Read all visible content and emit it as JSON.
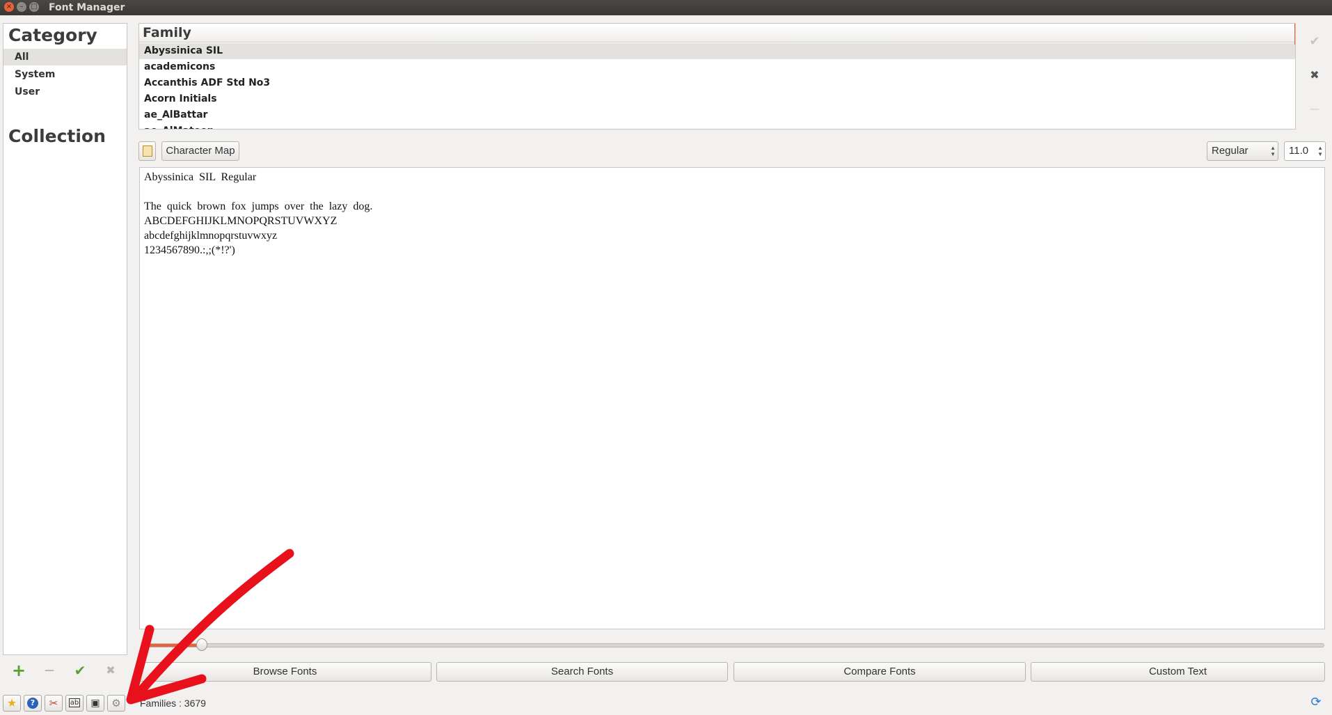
{
  "window": {
    "title": "Font Manager",
    "close_glyph": "×",
    "minimize_glyph": "–",
    "maximize_glyph": "□"
  },
  "sidebar": {
    "category_heading": "Category",
    "categories": [
      {
        "label": "All",
        "selected": true
      },
      {
        "label": "System"
      },
      {
        "label": "User"
      }
    ],
    "collection_heading": "Collection",
    "collection_buttons": [
      {
        "icon": "plus-icon",
        "glyph": "+",
        "color": "#5aa02c"
      },
      {
        "icon": "minus-icon",
        "glyph": "—",
        "color": "#b8b5b0"
      },
      {
        "icon": "checkmark-icon",
        "glyph": "✔",
        "color": "#5aa02c"
      },
      {
        "icon": "close-icon",
        "glyph": "✖",
        "color": "#b8b5b0"
      }
    ]
  },
  "family_list": {
    "header": "Family",
    "rows": [
      {
        "label": "Abyssinica SIL",
        "selected": true
      },
      {
        "label": "academicons"
      },
      {
        "label": "Accanthis ADF Std No3"
      },
      {
        "label": "Acorn Initials"
      },
      {
        "label": "ae_AlBattar"
      },
      {
        "label": "ae_AlMateen"
      }
    ],
    "side_buttons": [
      {
        "icon": "checkmark-icon",
        "glyph": "✔"
      },
      {
        "icon": "close-icon",
        "glyph": "✖"
      },
      {
        "icon": "minus-icon",
        "glyph": "—"
      }
    ]
  },
  "preview_toolbar": {
    "character_map_label": "Character Map",
    "style_value": "Regular",
    "size_value": "11.0"
  },
  "preview": {
    "lines": [
      "Abyssinica  SIL  Regular",
      "",
      "The  quick  brown  fox  jumps  over  the  lazy  dog.",
      "ABCDEFGHIJKLMNOPQRSTUVWXYZ",
      "abcdefghijklmnopqrstuvwxyz",
      "1234567890.:,;(*!?')"
    ]
  },
  "slider": {
    "value_fraction": 0.05,
    "accent": "#e9623c"
  },
  "modes": [
    "Browse Fonts",
    "Search Fonts",
    "Compare Fonts",
    "Custom Text"
  ],
  "bottom_toolbar": [
    {
      "icon": "star-icon",
      "glyph": "★",
      "color": "#e8b21a"
    },
    {
      "icon": "help-icon",
      "glyph": "?",
      "color": "#2b63b8"
    },
    {
      "icon": "tools-icon",
      "glyph": "✂",
      "color": "#c83a2a"
    },
    {
      "icon": "font-export-icon",
      "glyph": "ab",
      "color": "#333333"
    },
    {
      "icon": "save-icon",
      "glyph": "▣",
      "color": "#333333"
    },
    {
      "icon": "settings-icon",
      "glyph": "⚙",
      "color": "#888888"
    }
  ],
  "status": {
    "families_text": "Families : 3679"
  },
  "colors": {
    "accent": "#e9623c",
    "annotation_arrow": "#e8101b"
  }
}
